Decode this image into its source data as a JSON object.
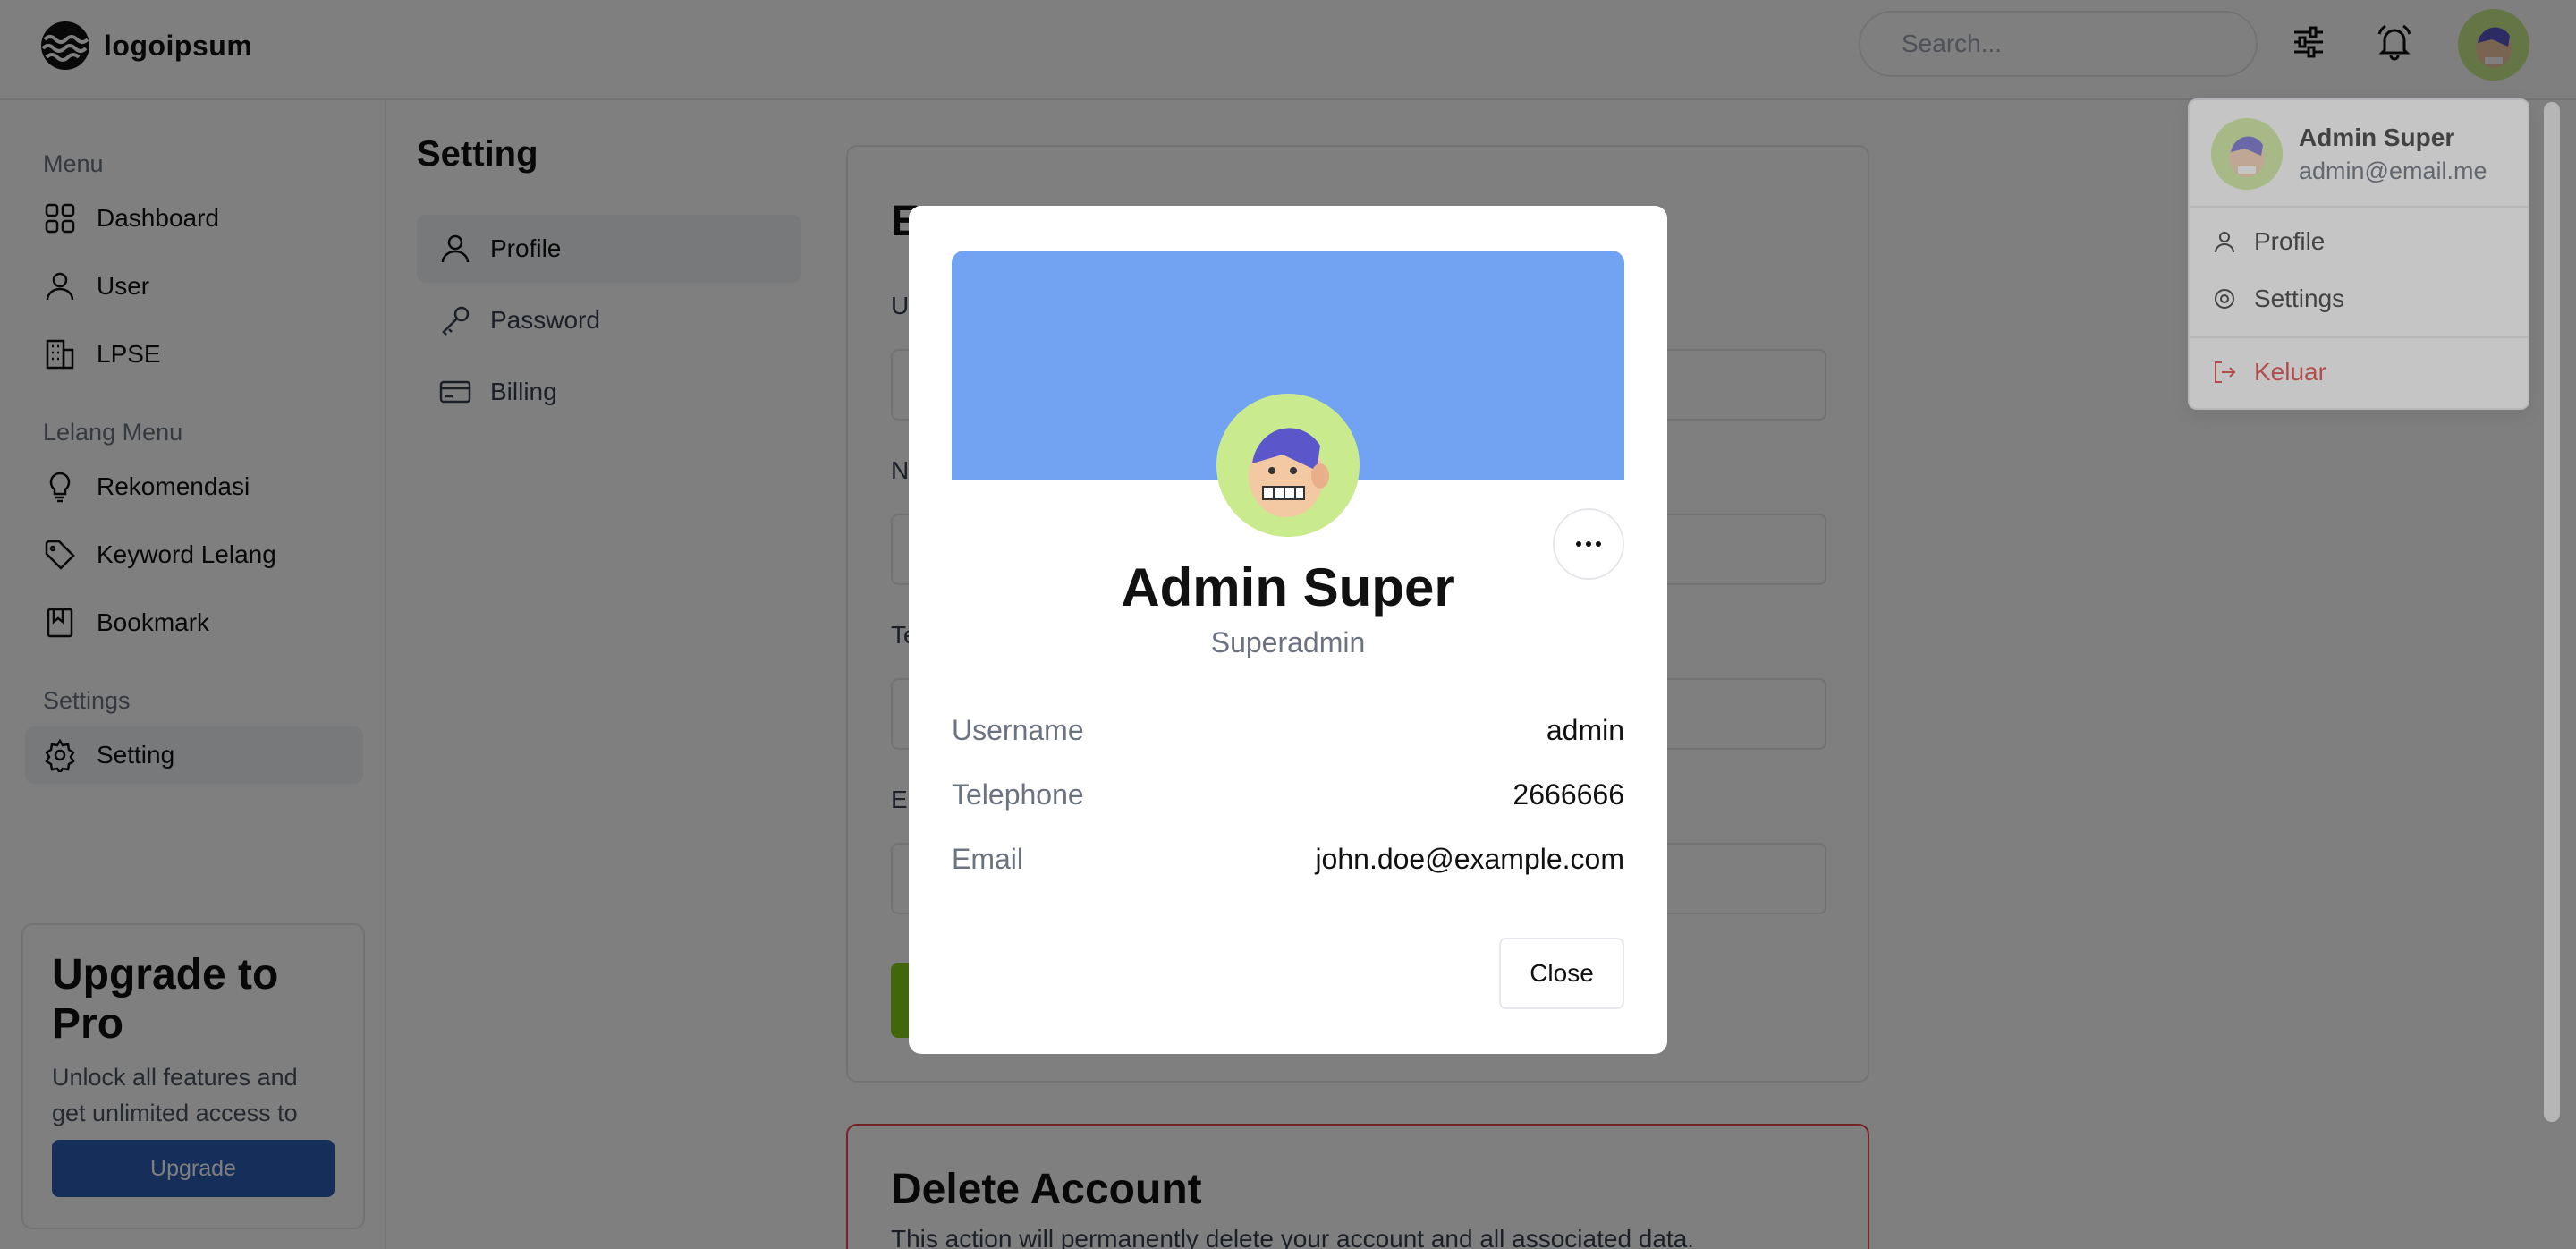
{
  "header": {
    "logo_text": "logoipsum",
    "search_placeholder": "Search..."
  },
  "sidebar": {
    "sections": [
      {
        "title": "Menu",
        "items": [
          {
            "label": "Dashboard"
          },
          {
            "label": "User"
          },
          {
            "label": "LPSE"
          }
        ]
      },
      {
        "title": "Lelang Menu",
        "items": [
          {
            "label": "Rekomendasi"
          },
          {
            "label": "Keyword Lelang"
          },
          {
            "label": "Bookmark"
          }
        ]
      },
      {
        "title": "Settings",
        "items": [
          {
            "label": "Setting"
          }
        ]
      }
    ],
    "upgrade": {
      "title": "Upgrade to Pro",
      "description": "Unlock all features and get unlimited access to our support team.",
      "button": "Upgrade"
    }
  },
  "main": {
    "title": "Setting",
    "nav": [
      {
        "label": "Profile"
      },
      {
        "label": "Password"
      },
      {
        "label": "Billing"
      }
    ],
    "delete_card": {
      "title": "Delete Account",
      "description": "This action will permanently delete your account and all associated data."
    }
  },
  "dropdown": {
    "name": "Admin Super",
    "email": "admin@email.me",
    "items": [
      {
        "label": "Profile"
      },
      {
        "label": "Settings"
      },
      {
        "label": "Keluar"
      }
    ]
  },
  "modal": {
    "name": "Admin Super",
    "role": "Superadmin",
    "fields": [
      {
        "label": "Username",
        "value": "admin"
      },
      {
        "label": "Telephone",
        "value": "2666666"
      },
      {
        "label": "Email",
        "value": "john.doe@example.com"
      }
    ],
    "close_label": "Close"
  },
  "colors": {
    "banner": "#71a3f2",
    "avatar_bg": "#c9ea8d",
    "upgrade_button": "#2b5fb4",
    "danger": "#dc2626"
  }
}
